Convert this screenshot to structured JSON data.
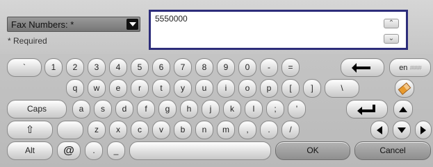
{
  "field_selector": {
    "label": "Fax Numbers: *",
    "icon": "dropdown-arrow-icon"
  },
  "required_note": "* Required",
  "input": {
    "value": "5550000"
  },
  "scroll": {
    "up": "^",
    "down": "v"
  },
  "keyboard": {
    "row1": [
      "`",
      "1",
      "2",
      "3",
      "4",
      "5",
      "6",
      "7",
      "8",
      "9",
      "0",
      "-",
      "="
    ],
    "row2": [
      "q",
      "w",
      "e",
      "r",
      "t",
      "y",
      "u",
      "i",
      "o",
      "p",
      "[",
      "]",
      "\\"
    ],
    "row3": [
      "a",
      "s",
      "d",
      "f",
      "g",
      "h",
      "j",
      "k",
      "l",
      ";",
      "'"
    ],
    "row4": [
      "z",
      "x",
      "c",
      "v",
      "b",
      "n",
      "m",
      ",",
      ".",
      "/"
    ],
    "caps": "Caps",
    "alt": "Alt",
    "at": "@",
    "dot": ".",
    "underscore": "_",
    "ok": "OK",
    "cancel": "Cancel",
    "lang": "en",
    "lang_grid": "####"
  }
}
